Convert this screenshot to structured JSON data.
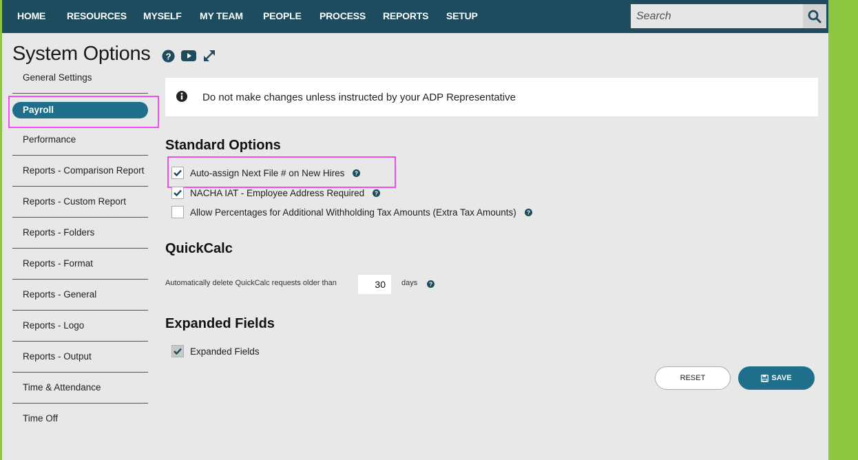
{
  "nav": {
    "items": [
      "HOME",
      "RESOURCES",
      "MYSELF",
      "MY TEAM",
      "PEOPLE",
      "PROCESS",
      "REPORTS",
      "SETUP"
    ],
    "search_placeholder": "Search"
  },
  "page": {
    "title": "System Options",
    "icons": [
      "help-circle-icon",
      "youtube-icon",
      "expand-icon"
    ]
  },
  "sidebar": {
    "items": [
      {
        "label": "General Settings",
        "active": false
      },
      {
        "label": "Payroll",
        "active": true
      },
      {
        "label": "Performance",
        "active": false
      },
      {
        "label": "Reports - Comparison Report",
        "active": false
      },
      {
        "label": "Reports - Custom Report",
        "active": false
      },
      {
        "label": "Reports - Folders",
        "active": false
      },
      {
        "label": "Reports - Format",
        "active": false
      },
      {
        "label": "Reports - General",
        "active": false
      },
      {
        "label": "Reports - Logo",
        "active": false
      },
      {
        "label": "Reports - Output",
        "active": false
      },
      {
        "label": "Time & Attendance",
        "active": false
      },
      {
        "label": "Time Off",
        "active": false
      }
    ]
  },
  "info": {
    "text": "Do not make changes unless instructed by your ADP Representative"
  },
  "standard_options": {
    "title": "Standard Options",
    "options": [
      {
        "label": "Auto-assign Next File # on New Hires",
        "checked": true
      },
      {
        "label": "NACHA IAT - Employee Address Required",
        "checked": true
      },
      {
        "label": "Allow Percentages for Additional Withholding Tax Amounts (Extra Tax Amounts)",
        "checked": false
      }
    ]
  },
  "quickcalc": {
    "title": "QuickCalc",
    "label": "Automatically delete QuickCalc requests older than",
    "value": "30",
    "unit": "days"
  },
  "expanded_fields": {
    "title": "Expanded Fields",
    "option": {
      "label": "Expanded Fields",
      "checked": true,
      "disabled": true
    }
  },
  "buttons": {
    "reset": "RESET",
    "save": "SAVE"
  },
  "colors": {
    "nav_bg": "#1c4c5e",
    "accent": "#1f6f8b",
    "highlight": "#f04cf0",
    "outer_bg": "#8dc63f"
  }
}
